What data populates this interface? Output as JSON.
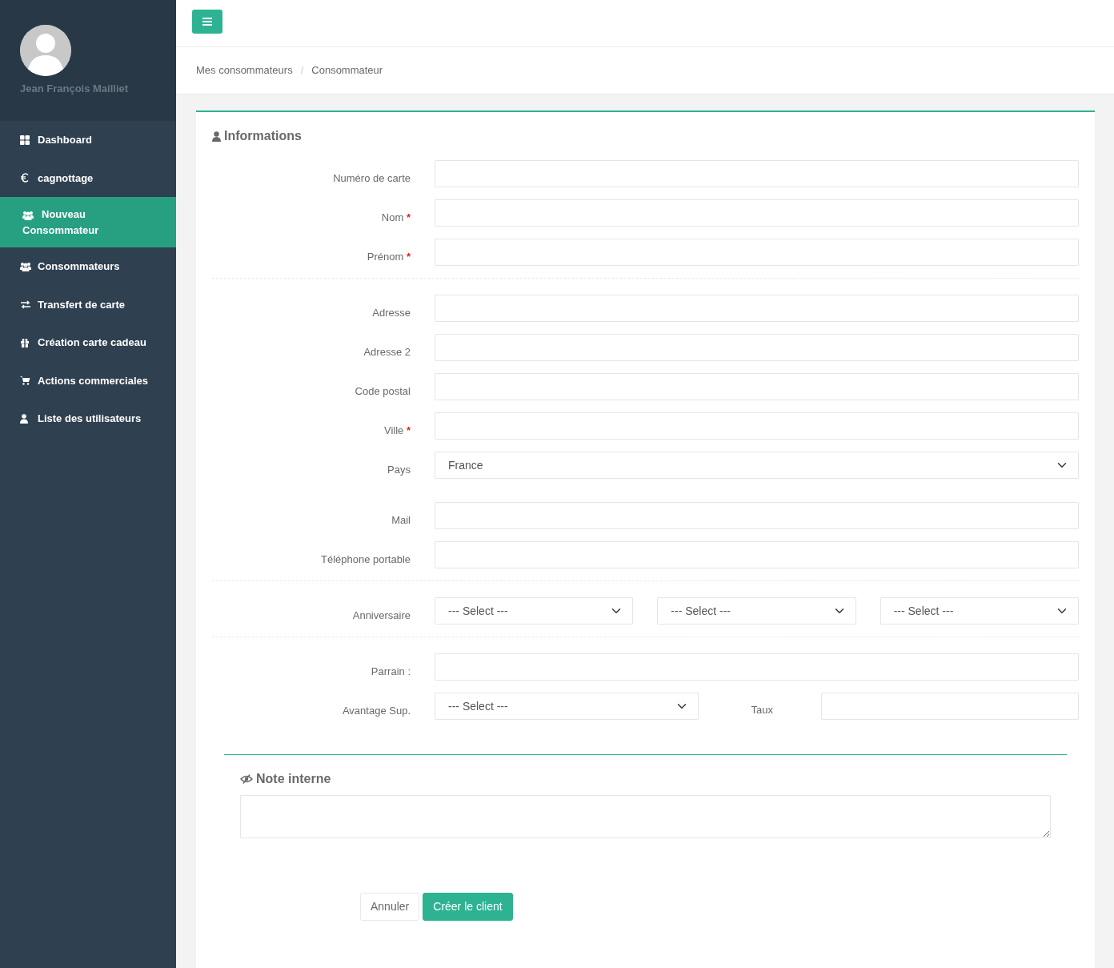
{
  "user": {
    "name": "Jean François Mailliet"
  },
  "sidebar": {
    "items": [
      {
        "label": "Dashboard",
        "kind": "grid",
        "selected": false
      },
      {
        "label": "cagnottage",
        "kind": "euro",
        "selected": false
      },
      {
        "label": "Nouveau Consommateur",
        "kind": "users",
        "selected": true
      },
      {
        "label": "Consommateurs",
        "kind": "users",
        "selected": false
      },
      {
        "label": "Transfert de carte",
        "kind": "arrows",
        "selected": false
      },
      {
        "label": "Création carte cadeau",
        "kind": "gift",
        "selected": false
      },
      {
        "label": "Actions commerciales",
        "kind": "cart",
        "selected": false
      },
      {
        "label": "Liste des utilisateurs",
        "kind": "user",
        "selected": false
      }
    ]
  },
  "breadcrumb": {
    "items": [
      "Mes consommateurs",
      "Consommateur"
    ],
    "separator": "/"
  },
  "form": {
    "title": "Informations",
    "groups": [
      {
        "divider": true,
        "rows": [
          {
            "label": "Numéro de carte",
            "controls": [
              {
                "kind": "input"
              }
            ]
          },
          {
            "label": "Nom",
            "required_mark": "*",
            "controls": [
              {
                "kind": "input"
              }
            ]
          },
          {
            "label": "Prénom",
            "required_mark": "*",
            "controls": [
              {
                "kind": "input"
              }
            ]
          }
        ]
      },
      {
        "divider": false,
        "rows": [
          {
            "label": "Adresse",
            "controls": [
              {
                "kind": "input"
              }
            ]
          },
          {
            "label": "Adresse 2",
            "controls": [
              {
                "kind": "input"
              }
            ]
          },
          {
            "label": "Code postal",
            "controls": [
              {
                "kind": "input"
              }
            ]
          },
          {
            "label": "Ville",
            "required_mark": "*",
            "controls": [
              {
                "kind": "input"
              }
            ]
          },
          {
            "label": "Pays",
            "controls": [
              {
                "kind": "select",
                "value": "France"
              }
            ]
          }
        ]
      },
      {
        "divider": true,
        "rows": [
          {
            "label": "Mail",
            "controls": [
              {
                "kind": "input"
              }
            ]
          },
          {
            "label": "Téléphone portable",
            "controls": [
              {
                "kind": "input"
              }
            ]
          }
        ]
      },
      {
        "divider": true,
        "rows": [
          {
            "label": "Anniversaire",
            "controls": [
              {
                "kind": "select",
                "value": "--- Select ---"
              },
              {
                "kind": "select",
                "value": "--- Select ---"
              },
              {
                "kind": "select",
                "value": "--- Select ---"
              }
            ]
          }
        ]
      },
      {
        "divider": false,
        "rows": [
          {
            "label": "Parrain :",
            "controls": [
              {
                "kind": "input"
              }
            ]
          },
          {
            "label": "Avantage Sup.",
            "controls": [
              {
                "kind": "select",
                "value": "--- Select ---"
              },
              {
                "kind": "input",
                "label": "Taux"
              }
            ]
          }
        ]
      }
    ]
  },
  "note": {
    "title": "Note interne"
  },
  "buttons": [
    {
      "label": "Annuler",
      "kind": "secondary"
    },
    {
      "label": "Créer le client",
      "kind": "primary"
    }
  ]
}
